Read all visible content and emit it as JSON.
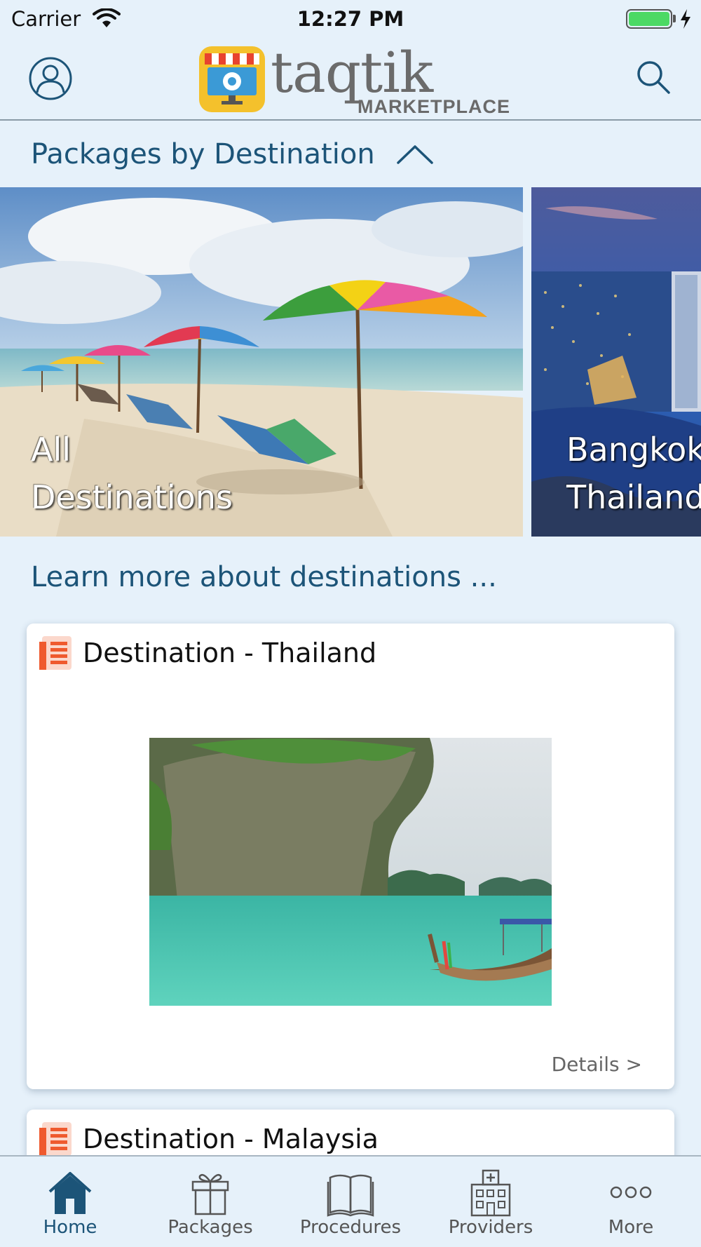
{
  "status_bar": {
    "carrier": "Carrier",
    "time": "12:27 PM"
  },
  "header": {
    "logo_text": "taqtik",
    "logo_subtext": "MARKETPLACE",
    "profile_icon": "user-circle-icon",
    "search_icon": "search-icon"
  },
  "packages_section": {
    "title": "Packages by Destination",
    "toggle_icon": "chevron-up-icon",
    "destinations": [
      {
        "line1": "All",
        "line2": "Destinations"
      },
      {
        "line1": "Bangkok",
        "line2": "Thailand"
      }
    ]
  },
  "learn_section": {
    "title": "Learn more about destinations ...",
    "articles": [
      {
        "title": "Destination - Thailand",
        "details_label": "Details >"
      },
      {
        "title": "Destination - Malaysia"
      }
    ]
  },
  "tab_bar": {
    "tabs": [
      {
        "label": "Home",
        "icon": "home-icon",
        "active": true
      },
      {
        "label": "Packages",
        "icon": "gift-icon"
      },
      {
        "label": "Procedures",
        "icon": "book-icon"
      },
      {
        "label": "Providers",
        "icon": "hospital-icon"
      },
      {
        "label": "More",
        "icon": "more-dots-icon"
      }
    ]
  },
  "colors": {
    "background": "#e6f1fa",
    "accent_text": "#1c5478",
    "battery": "#4cd964",
    "article_icon": "#ef5a2e"
  }
}
